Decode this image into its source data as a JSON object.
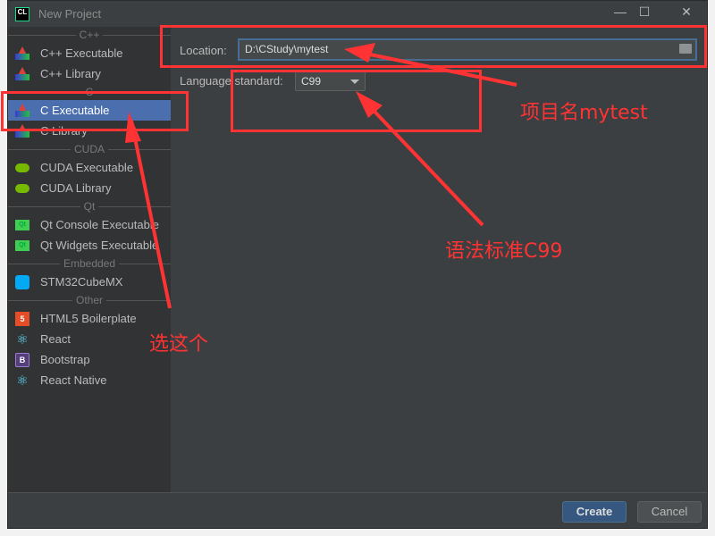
{
  "window": {
    "title": "New Project",
    "logo": "CL",
    "minimize": "minimize-icon",
    "maximize": "maximize-icon",
    "close": "close-icon"
  },
  "sidebar": {
    "groups": [
      {
        "label": "C++",
        "items": [
          {
            "label": "C++ Executable",
            "icon": "clion-triangle"
          },
          {
            "label": "C++ Library",
            "icon": "clion-triangle"
          }
        ]
      },
      {
        "label": "C",
        "items": [
          {
            "label": "C Executable",
            "icon": "clion-triangle",
            "selected": true
          },
          {
            "label": "C Library",
            "icon": "clion-triangle"
          }
        ]
      },
      {
        "label": "CUDA",
        "items": [
          {
            "label": "CUDA Executable",
            "icon": "nvidia"
          },
          {
            "label": "CUDA Library",
            "icon": "nvidia"
          }
        ]
      },
      {
        "label": "Qt",
        "items": [
          {
            "label": "Qt Console Executable",
            "icon": "qt"
          },
          {
            "label": "Qt Widgets Executable",
            "icon": "qt"
          }
        ]
      },
      {
        "label": "Embedded",
        "items": [
          {
            "label": "STM32CubeMX",
            "icon": "cube"
          }
        ]
      },
      {
        "label": "Other",
        "items": [
          {
            "label": "HTML5 Boilerplate",
            "icon": "html5"
          },
          {
            "label": "React",
            "icon": "react"
          },
          {
            "label": "Bootstrap",
            "icon": "bootstrap"
          },
          {
            "label": "React Native",
            "icon": "react"
          }
        ]
      }
    ]
  },
  "form": {
    "location_label": "Location:",
    "location_value": "D:\\CStudy\\mytest",
    "language_label": "Language standard:",
    "language_value": "C99"
  },
  "footer": {
    "create": "Create",
    "cancel": "Cancel"
  },
  "annotations": {
    "project_name": "项目名mytest",
    "standard": "语法标准C99",
    "choose": "选这个",
    "color": "#ff3333"
  }
}
